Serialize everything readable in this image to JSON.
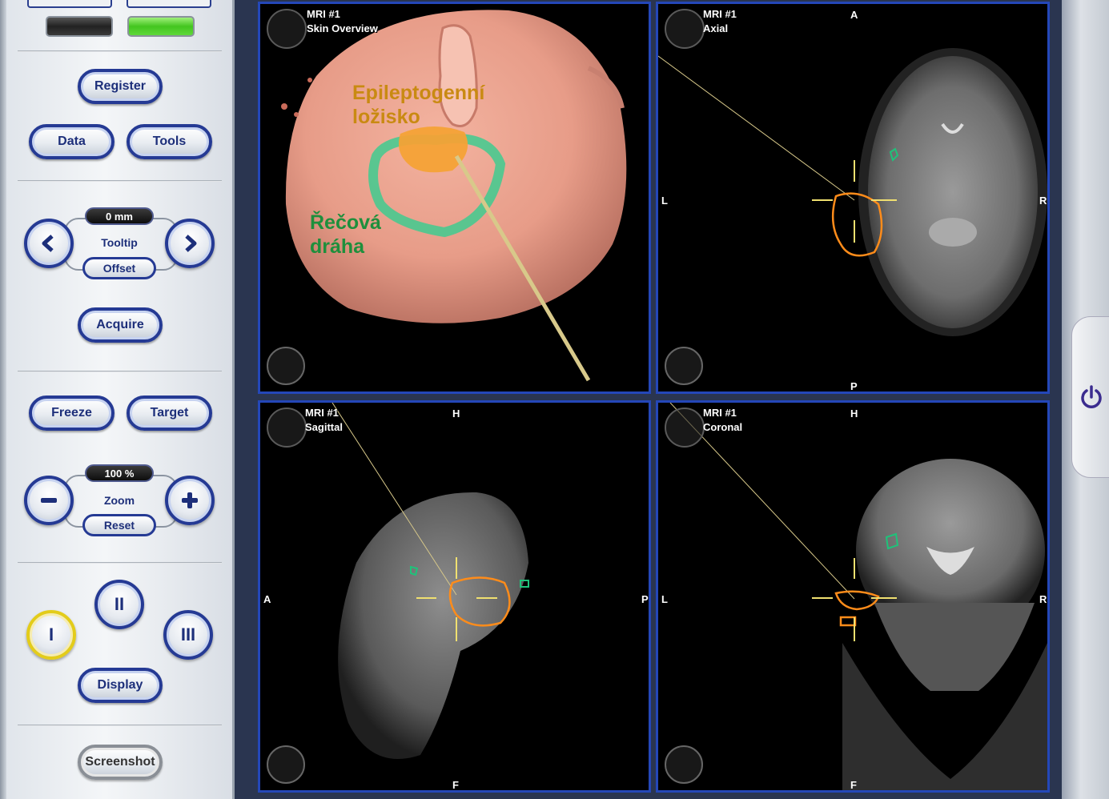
{
  "panel": {
    "register": "Register",
    "data": "Data",
    "tools": "Tools",
    "tooltip": {
      "readout": "0 mm",
      "caption": "Tooltip",
      "offset": "Offset",
      "prev_icon": "chevron-left-icon",
      "next_icon": "chevron-right-icon"
    },
    "acquire": "Acquire",
    "freeze": "Freeze",
    "target": "Target",
    "zoom": {
      "readout": "100 %",
      "caption": "Zoom",
      "reset": "Reset",
      "minus_icon": "minus-icon",
      "plus_icon": "plus-icon"
    },
    "layouts": {
      "one": "I",
      "two": "II",
      "three": "III",
      "selected": "I"
    },
    "display": "Display",
    "screenshot": "Screenshot",
    "status_leds": [
      "off",
      "on"
    ]
  },
  "views": {
    "skin": {
      "title": "MRI #1",
      "subtitle": "Skin Overview",
      "annotation_focus": "Epileptogenní ložisko",
      "annotation_focus_lines": [
        "Epileptogenní",
        "ložisko"
      ],
      "annotation_tract_lines": [
        "Řečová",
        "dráha"
      ],
      "focus_color": "#c98a12",
      "tract_color": "#1e8f3c"
    },
    "axial": {
      "title": "MRI #1",
      "subtitle": "Axial",
      "top": "A",
      "bottom": "P",
      "left": "L",
      "right": "R"
    },
    "sagittal": {
      "title": "MRI #1",
      "subtitle": "Sagittal",
      "top": "H",
      "bottom": "F",
      "left": "A",
      "right": "P"
    },
    "coronal": {
      "title": "MRI #1",
      "subtitle": "Coronal",
      "top": "H",
      "bottom": "F",
      "left": "L",
      "right": "R"
    }
  },
  "colors": {
    "frame": "#2447b8",
    "crosshair": "#f0e070",
    "lesion_outline": "#ff8c1a",
    "tract_outline": "#1fc27a"
  },
  "power_icon": "power-icon"
}
